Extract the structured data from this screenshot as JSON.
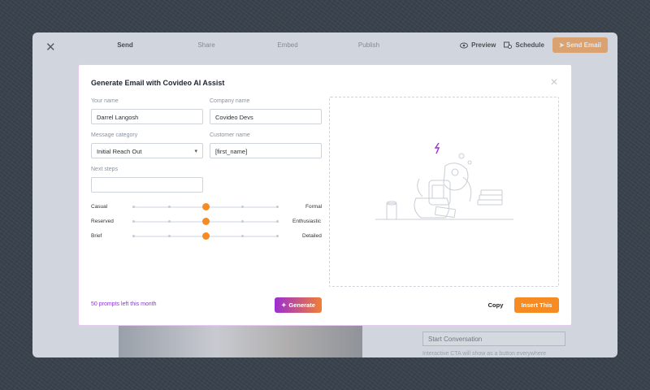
{
  "app": {
    "steps": [
      "Send",
      "Share",
      "Embed",
      "Publish"
    ],
    "active_step": 0,
    "preview_label": "Preview",
    "schedule_label": "Schedule",
    "send_email_label": "Send Email",
    "bg_select_value": "Start Conversation",
    "bg_note": "Interactive CTA will show as a button everywhere"
  },
  "modal": {
    "title": "Generate Email with Covideo AI Assist",
    "your_name": {
      "label": "Your name",
      "value": "Darrel Langosh"
    },
    "company_name": {
      "label": "Company name",
      "value": "Covideo Devs"
    },
    "message_category": {
      "label": "Message category",
      "value": "Initial Reach Out"
    },
    "customer_name": {
      "label": "Customer name",
      "value": "[first_name]"
    },
    "next_steps": {
      "label": "Next steps",
      "value": ""
    },
    "sliders": [
      {
        "left": "Casual",
        "right": "Formal",
        "value": 0.5
      },
      {
        "left": "Reserved",
        "right": "Enthusiastic",
        "value": 0.5
      },
      {
        "left": "Brief",
        "right": "Detailed",
        "value": 0.5
      }
    ],
    "prompts_left": "50 prompts left this month",
    "generate_label": "Generate",
    "copy_label": "Copy",
    "insert_label": "Insert This"
  },
  "colors": {
    "accent": "#f58b22",
    "purple": "#9b2fd1"
  },
  "icons": [
    "close-icon",
    "eye-icon",
    "schedule-icon",
    "send-icon",
    "sparkle-icon",
    "chevron-down-icon",
    "robot-illustration"
  ]
}
